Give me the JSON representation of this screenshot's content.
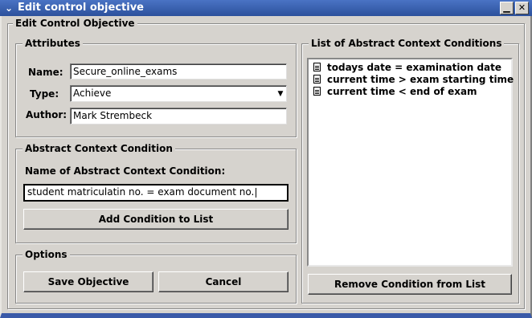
{
  "window": {
    "title": "Edit control objective",
    "minimize_glyph": "▁",
    "close_glyph": "✕",
    "menu_glyph": "⌄"
  },
  "main_group": {
    "legend": "Edit Control Objective"
  },
  "attributes": {
    "legend": "Attributes",
    "name_label": "Name:",
    "name_value": "Secure_online_exams",
    "type_label": "Type:",
    "type_value": "Achieve",
    "author_label": "Author:",
    "author_value": "Mark Strembeck"
  },
  "condition": {
    "legend": "Abstract Context Condition",
    "name_label": "Name of Abstract Context Condition:",
    "input_value": "student matriculatin no. = exam document no.",
    "add_button": "Add Condition to List"
  },
  "options": {
    "legend": "Options",
    "save_button": "Save Objective",
    "cancel_button": "Cancel"
  },
  "list": {
    "legend": "List of Abstract Context Conditions",
    "items": [
      "todays date = examination date",
      "current time > exam starting time",
      "current time < end of exam"
    ],
    "remove_button": "Remove Condition from List"
  }
}
